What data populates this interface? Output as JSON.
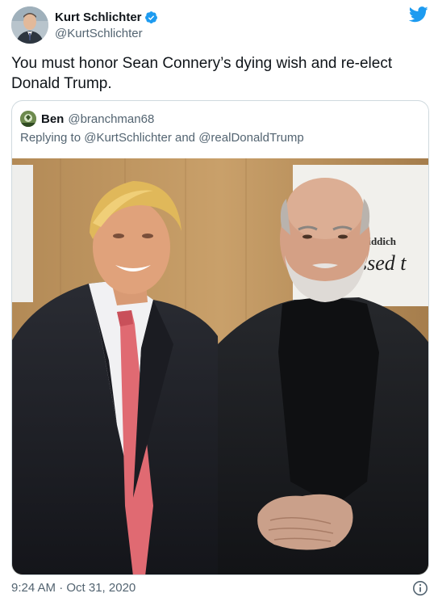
{
  "author": {
    "name": "Kurt Schlichter",
    "handle": "@KurtSchlichter",
    "verified": true
  },
  "tweet": {
    "text": "You must honor Sean Connery’s dying wish and re-elect Donald Trump.",
    "timestamp": "9:24 AM · Oct 31, 2020"
  },
  "quote": {
    "name": "Ben",
    "handle": "@branchman68",
    "replying_prefix": "Replying to",
    "mention_1": "@KurtSchlichter",
    "conjunction": "and",
    "mention_2": "@realDonaldTrump",
    "photo_sign_top": "fiddich",
    "photo_sign_bottom": "ssed t"
  },
  "colors": {
    "brand_blue": "#1d9bf0",
    "secondary_text": "#536471",
    "border": "#cfd9de"
  },
  "icons": {
    "platform": "twitter-bird-icon",
    "verified": "verified-badge-icon",
    "info": "info-icon"
  }
}
